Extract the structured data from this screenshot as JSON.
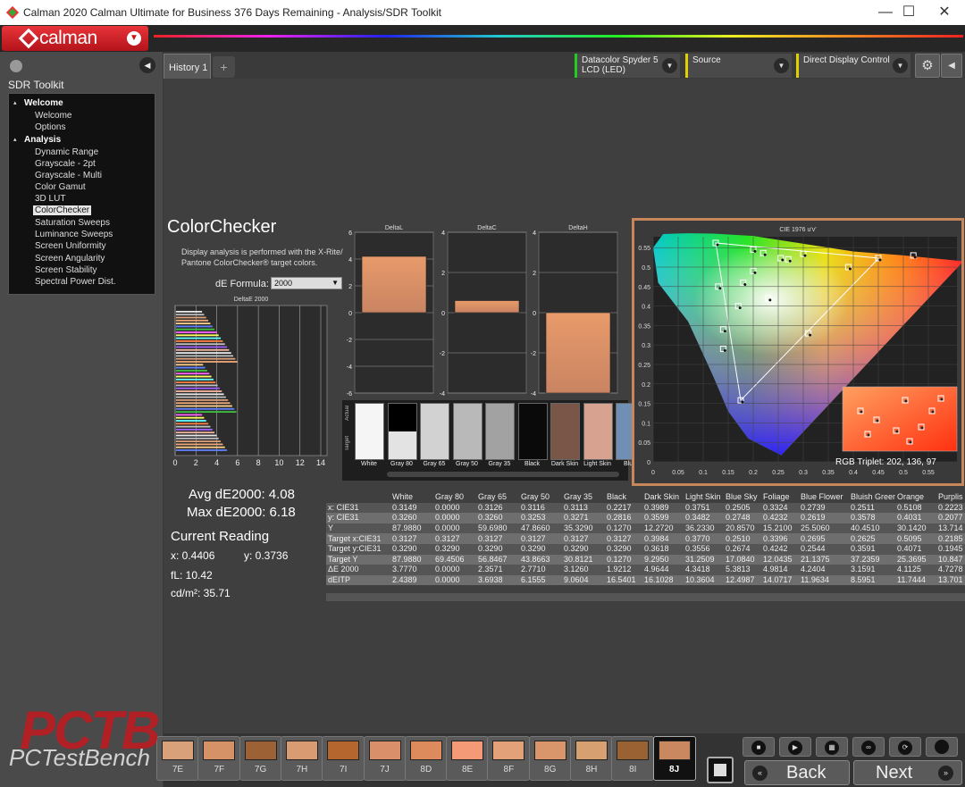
{
  "window": {
    "title": "Calman 2020 Calman Ultimate for Business 376 Days Remaining - Analysis/SDR Toolkit",
    "minimize": "—",
    "maximize": "☐",
    "close": "✕"
  },
  "brand": {
    "logo_text": "calman"
  },
  "sidebar": {
    "title": "SDR Toolkit",
    "groups": [
      {
        "label": "Welcome",
        "items": [
          "Welcome",
          "Options"
        ]
      },
      {
        "label": "Analysis",
        "items": [
          "Dynamic Range",
          "Grayscale - 2pt",
          "Grayscale - Multi",
          "Color Gamut",
          "3D LUT",
          "ColorChecker",
          "Saturation Sweeps",
          "Luminance Sweeps",
          "Screen Uniformity",
          "Screen Angularity",
          "Screen Stability",
          "Spectral Power Dist."
        ]
      }
    ],
    "selected": "ColorChecker"
  },
  "tabs": {
    "history": "History 1",
    "add": "+"
  },
  "devices": {
    "meter_line1": "Datacolor Spyder 5",
    "meter_line2": "LCD (LED)",
    "meter_color": "#22cc22",
    "source": "Source",
    "source_color": "#e0d000",
    "display": "Direct Display Control",
    "display_color": "#e0d000"
  },
  "colorchecker": {
    "title": "ColorChecker",
    "description": "Display analysis is performed with the X-Rite/ Pantone ColorChecker® target colors.",
    "de_formula_label": "dE Formula:",
    "de_formula_value": "2000"
  },
  "de_chart": {
    "title": "DeltaE 2000",
    "ticks": [
      "0",
      "2",
      "4",
      "6",
      "8",
      "10",
      "12",
      "14"
    ]
  },
  "delta_charts": [
    {
      "title": "DeltaL",
      "value": 4.2,
      "ticks": [
        "6",
        "4",
        "2",
        "0",
        "-2",
        "-4",
        "-6"
      ]
    },
    {
      "title": "DeltaC",
      "value": 0.6,
      "ticks": [
        "4",
        "2",
        "0",
        "-2",
        "-4"
      ]
    },
    {
      "title": "DeltaH",
      "value": -4.0,
      "ticks": [
        "4",
        "2",
        "0",
        "-2",
        "-4"
      ]
    }
  ],
  "swatches": {
    "actual_label": "Actual",
    "target_label": "Target",
    "items": [
      {
        "label": "White",
        "actual": "#f5f5f5",
        "target": "#f5f5f5"
      },
      {
        "label": "Gray 80",
        "actual": "#000000",
        "target": "#e3e3e3"
      },
      {
        "label": "Gray 65",
        "actual": "#d2d2d2",
        "target": "#d2d2d2"
      },
      {
        "label": "Gray 50",
        "actual": "#b9b9b9",
        "target": "#b9b9b9"
      },
      {
        "label": "Gray 35",
        "actual": "#a2a2a2",
        "target": "#a2a2a2"
      },
      {
        "label": "Black",
        "actual": "#0a0a0a",
        "target": "#0a0a0a"
      },
      {
        "label": "Dark Skin",
        "actual": "#7a5648",
        "target": "#7a5648"
      },
      {
        "label": "Light Skin",
        "actual": "#d7a290",
        "target": "#d7a290"
      },
      {
        "label": "Blue",
        "actual": "#6f8fb5",
        "target": "#6f8fb5"
      }
    ]
  },
  "cie": {
    "title": "CIE 1976 u'v'",
    "rgb_triplet": "RGB Triplet: 202, 136, 97",
    "x_ticks": [
      "0",
      "0.05",
      "0.1",
      "0.15",
      "0.2",
      "0.25",
      "0.3",
      "0.35",
      "0.4",
      "0.45",
      "0.5",
      "0.55"
    ],
    "y_ticks": [
      "0.55",
      "0.5",
      "0.45",
      "0.4",
      "0.35",
      "0.3",
      "0.25",
      "0.2",
      "0.15",
      "0.1",
      "0.05",
      "0"
    ]
  },
  "stats": {
    "avg": "Avg dE2000: 4.08",
    "max": "Max dE2000: 6.18",
    "current_reading": "Current Reading",
    "x": "x: 0.4406",
    "y": "y: 0.3736",
    "fl": "fL: 10.42",
    "cdm2": "cd/m²: 35.71"
  },
  "table": {
    "columns": [
      "White",
      "Gray 80",
      "Gray 65",
      "Gray 50",
      "Gray 35",
      "Black",
      "Dark Skin",
      "Light Skin",
      "Blue Sky",
      "Foliage",
      "Blue Flower",
      "Bluish Green",
      "Orange",
      "Purplis"
    ],
    "rows": [
      {
        "label": "x: CIE31",
        "values": [
          "0.3149",
          "0.0000",
          "0.3126",
          "0.3116",
          "0.3113",
          "0.2217",
          "0.3989",
          "0.3751",
          "0.2505",
          "0.3324",
          "0.2739",
          "0.2511",
          "0.5108",
          "0.2223"
        ]
      },
      {
        "label": "y: CIE31",
        "values": [
          "0.3260",
          "0.0000",
          "0.3260",
          "0.3253",
          "0.3271",
          "0.2816",
          "0.3599",
          "0.3482",
          "0.2748",
          "0.4232",
          "0.2619",
          "0.3578",
          "0.4031",
          "0.2077"
        ]
      },
      {
        "label": "Y",
        "values": [
          "87.9880",
          "0.0000",
          "59.6980",
          "47.8660",
          "35.3290",
          "0.1270",
          "12.2720",
          "36.2330",
          "20.8570",
          "15.2100",
          "25.5060",
          "40.4510",
          "30.1420",
          "13.714"
        ]
      },
      {
        "label": "Target x:CIE31",
        "values": [
          "0.3127",
          "0.3127",
          "0.3127",
          "0.3127",
          "0.3127",
          "0.3127",
          "0.3984",
          "0.3770",
          "0.2510",
          "0.3396",
          "0.2695",
          "0.2625",
          "0.5095",
          "0.2185"
        ]
      },
      {
        "label": "Target y:CIE31",
        "values": [
          "0.3290",
          "0.3290",
          "0.3290",
          "0.3290",
          "0.3290",
          "0.3290",
          "0.3618",
          "0.3556",
          "0.2674",
          "0.4242",
          "0.2544",
          "0.3591",
          "0.4071",
          "0.1945"
        ]
      },
      {
        "label": "Target Y",
        "values": [
          "87.9880",
          "69.4506",
          "56.8467",
          "43.8663",
          "30.8121",
          "0.1270",
          "9.2950",
          "31.2509",
          "17.0840",
          "12.0435",
          "21.1375",
          "37.2359",
          "25.3695",
          "10.847"
        ]
      },
      {
        "label": "ΔE 2000",
        "values": [
          "3.7770",
          "0.0000",
          "2.3571",
          "2.7710",
          "3.1260",
          "1.9212",
          "4.9644",
          "4.3418",
          "5.3813",
          "4.9814",
          "4.2404",
          "3.1591",
          "4.1125",
          "4.7278"
        ]
      },
      {
        "label": "dEITP",
        "values": [
          "2.4389",
          "0.0000",
          "3.6938",
          "6.1555",
          "9.0604",
          "16.5401",
          "16.1028",
          "10.3604",
          "12.4987",
          "14.0717",
          "11.9634",
          "8.5951",
          "11.7444",
          "13.701"
        ]
      }
    ]
  },
  "patches": [
    {
      "label": "7E",
      "color": "#d9a17a"
    },
    {
      "label": "7F",
      "color": "#d49266"
    },
    {
      "label": "7G",
      "color": "#9c6236"
    },
    {
      "label": "7H",
      "color": "#d99c72"
    },
    {
      "label": "7I",
      "color": "#b4662e"
    },
    {
      "label": "7J",
      "color": "#d9906a"
    },
    {
      "label": "8D",
      "color": "#dd8a5c"
    },
    {
      "label": "8E",
      "color": "#f59a76"
    },
    {
      "label": "8F",
      "color": "#e3a17a"
    },
    {
      "label": "8G",
      "color": "#d9966a"
    },
    {
      "label": "8H",
      "color": "#d6a070"
    },
    {
      "label": "8I",
      "color": "#9a6232"
    },
    {
      "label": "8J",
      "color": "#ca8861"
    }
  ],
  "nav": {
    "back": "Back",
    "next": "Next"
  },
  "watermark": {
    "big": "PCTB",
    "small": "PCTestBench"
  }
}
